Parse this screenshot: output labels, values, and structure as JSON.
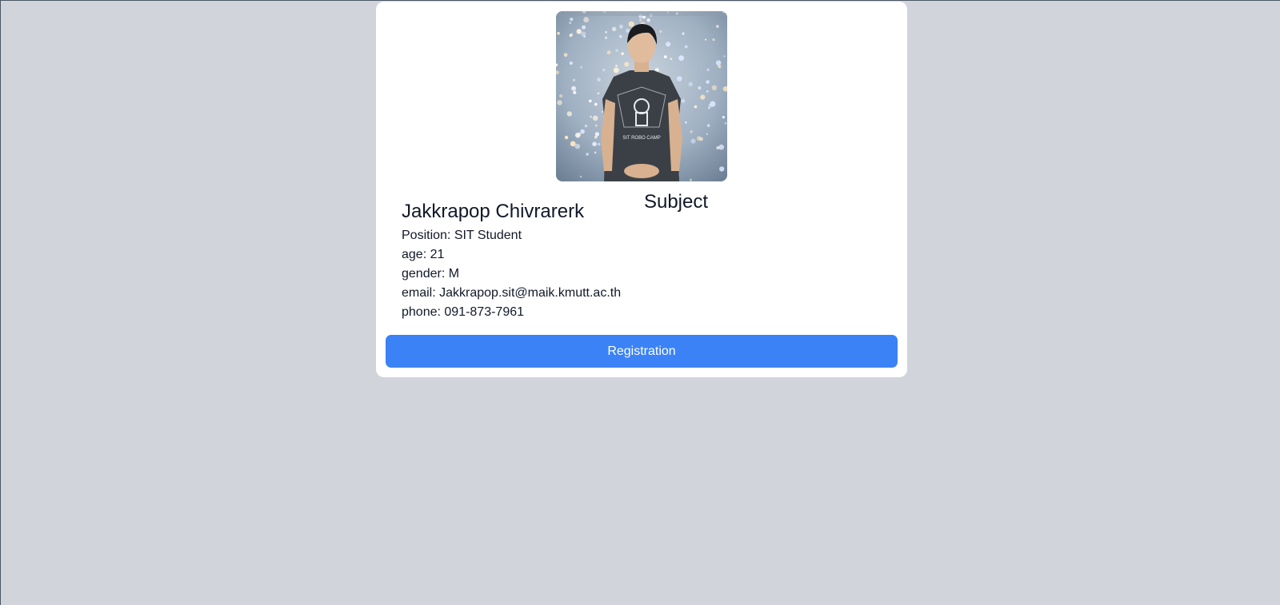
{
  "profile": {
    "name": "Jakkrapop Chivrarerk",
    "details": [
      "Position: SIT Student",
      "age: 21",
      "gender: M",
      "email: Jakkrapop.sit@maik.kmutt.ac.th",
      "phone: 091-873-7961"
    ],
    "photo_icon": "person-photo",
    "shirt_text": "SIT ROBO CAMP"
  },
  "subject": {
    "title": "Subject"
  },
  "actions": {
    "registration_label": "Registration"
  },
  "colors": {
    "background": "#d1d5db",
    "card": "#ffffff",
    "primary_button": "#3b82f6",
    "text": "#111827"
  }
}
